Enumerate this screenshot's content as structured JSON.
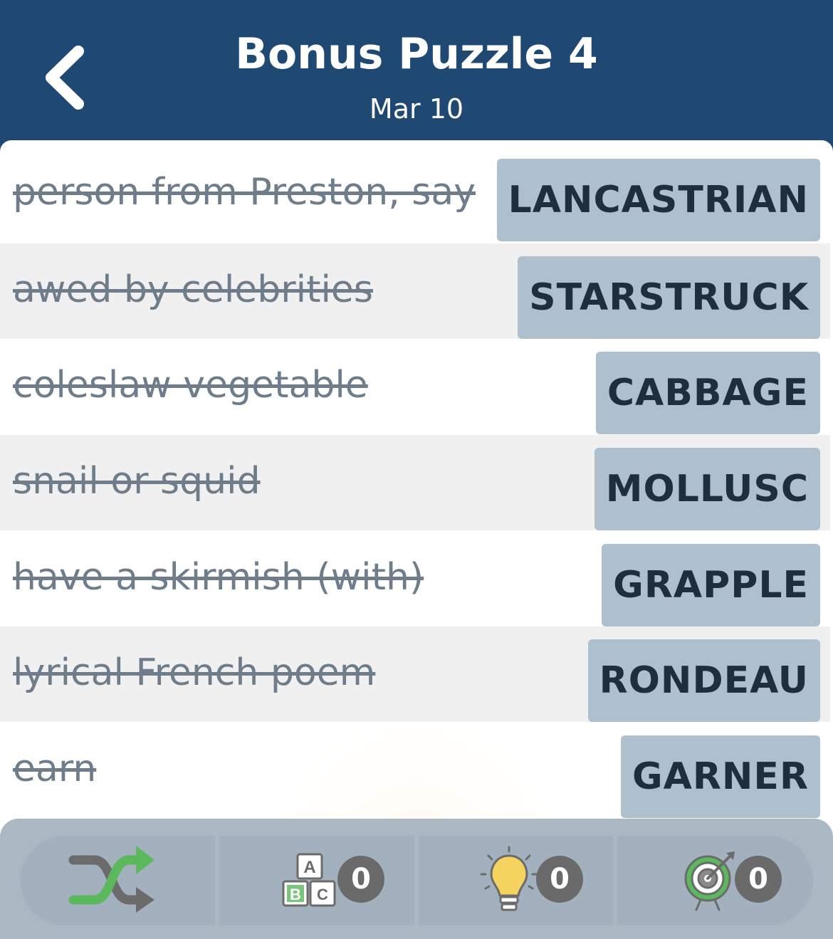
{
  "header": {
    "title": "Bonus Puzzle 4",
    "date": "Mar 10",
    "back_icon": "chevron-left-icon"
  },
  "clues": [
    {
      "clue": "person from Preston, say",
      "answer": "LANCASTRIAN"
    },
    {
      "clue": "awed by celebrities",
      "answer": "STARSTRUCK"
    },
    {
      "clue": "coleslaw vegetable",
      "answer": "CABBAGE"
    },
    {
      "clue": "snail or squid",
      "answer": "MOLLUSC"
    },
    {
      "clue": "have a skirmish (with)",
      "answer": "GRAPPLE"
    },
    {
      "clue": "lyrical French poem",
      "answer": "RONDEAU"
    },
    {
      "clue": "earn",
      "answer": "GARNER"
    }
  ],
  "toolbar": {
    "shuffle_icon": "shuffle-icon",
    "letters": {
      "icon": "letter-blocks-icon",
      "count": "0",
      "blocks": [
        "A",
        "B",
        "C"
      ]
    },
    "hint": {
      "icon": "lightbulb-icon",
      "count": "0"
    },
    "target": {
      "icon": "target-icon",
      "count": "0"
    }
  },
  "colors": {
    "header_bg": "#1f4872",
    "answer_bg": "#aebfcd",
    "clue_text": "#6f7d8a",
    "toolbar_bg": "#aab8c4",
    "badge_bg": "#6a6a6a",
    "shuffle_green": "#5cb85c"
  }
}
